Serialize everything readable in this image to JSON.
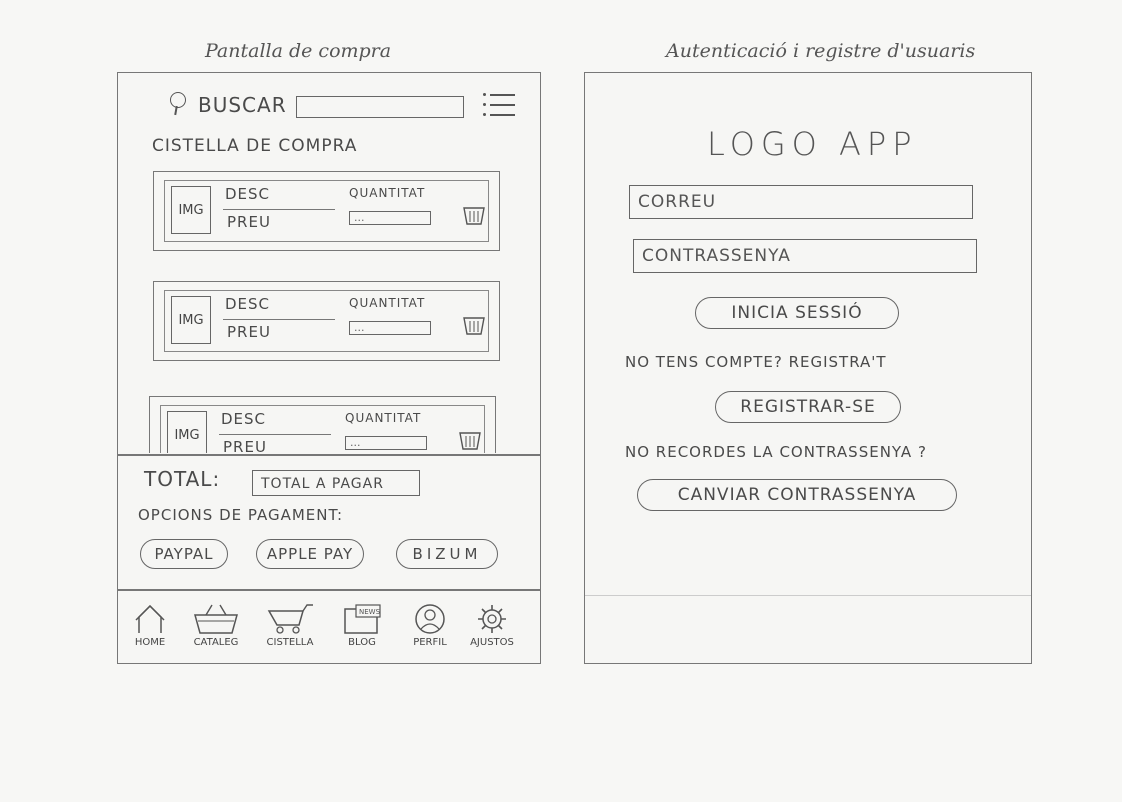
{
  "shop": {
    "caption": "Pantalla de compra",
    "search_label": "BUSCAR",
    "cart_title": "CISTELLA DE COMPRA",
    "items": [
      {
        "img": "IMG",
        "desc": "DESC",
        "price": "PREU",
        "qty_label": "QUANTITAT",
        "qty_value": "..."
      },
      {
        "img": "IMG",
        "desc": "DESC",
        "price": "PREU",
        "qty_label": "QUANTITAT",
        "qty_value": "..."
      },
      {
        "img": "IMG",
        "desc": "DESC",
        "price": "PREU",
        "qty_label": "QUANTITAT",
        "qty_value": "..."
      }
    ],
    "total_label": "TOTAL:",
    "total_value": "TOTAL A PAGAR",
    "payment_title": "OPCIONS DE PAGAMENT:",
    "payment_options": [
      "PAYPAL",
      "APPLE PAY",
      "BIZUM"
    ],
    "nav": [
      {
        "label": "HOME",
        "icon": "home-icon"
      },
      {
        "label": "CATALEG",
        "icon": "catalog-basket-icon"
      },
      {
        "label": "CISTELLA",
        "icon": "cart-icon"
      },
      {
        "label": "BLOG",
        "icon": "news-icon",
        "icon_text": "NEWS"
      },
      {
        "label": "PERFIL",
        "icon": "profile-icon"
      },
      {
        "label": "AJUSTOS",
        "icon": "gear-icon"
      }
    ]
  },
  "auth": {
    "caption": "Autenticació i registre d'usuaris",
    "logo": "LOGO APP",
    "email_placeholder": "CORREU",
    "password_placeholder": "CONTRASSENYA",
    "login_button": "INICIA SESSIÓ",
    "no_account_text": "NO TENS COMPTE? REGISTRA'T",
    "register_button": "REGISTRAR-SE",
    "forgot_text": "NO RECORDES LA CONTRASSENYA ?",
    "change_password_button": "CANVIAR CONTRASSENYA"
  },
  "colors": {
    "pencil": "#555555",
    "paper": "#f7f7f5"
  }
}
